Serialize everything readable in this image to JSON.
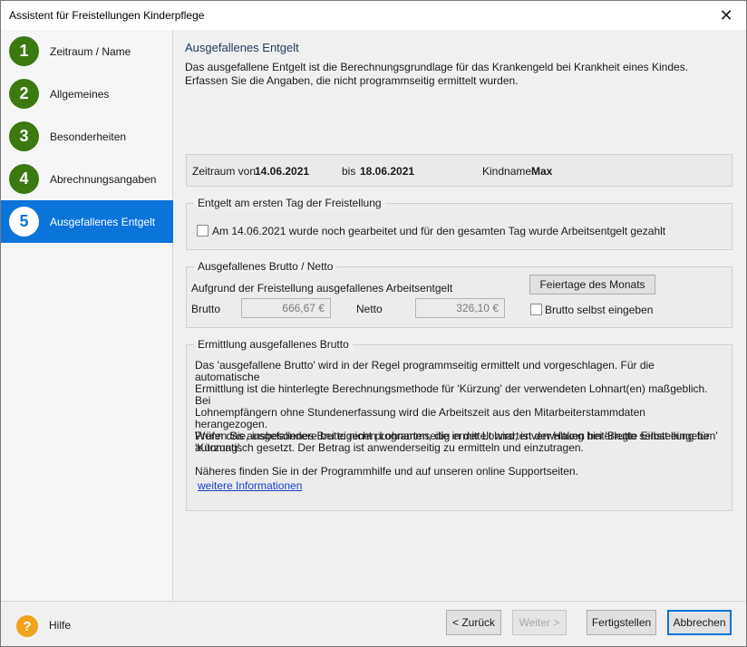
{
  "window": {
    "title": "Assistent für Freistellungen Kinderpflege",
    "close": "✕"
  },
  "steps": [
    {
      "num": "1",
      "label": "Zeitraum / Name"
    },
    {
      "num": "2",
      "label": "Allgemeines"
    },
    {
      "num": "3",
      "label": "Besonderheiten"
    },
    {
      "num": "4",
      "label": "Abrechnungsangaben"
    },
    {
      "num": "5",
      "label": "Ausgefallenes Entgelt"
    }
  ],
  "main": {
    "heading": "Ausgefallenes Entgelt",
    "description_line1": "Das ausgefallene Entgelt ist die Berechnungsgrundlage für das Krankengeld bei Krankheit eines Kindes.",
    "description_line2": "Erfassen Sie die Angaben, die nicht programmseitig ermittelt wurden."
  },
  "period": {
    "from_label": "Zeitraum von",
    "from_value": "14.06.2021",
    "to_label": "bis",
    "to_value": "18.06.2021",
    "child_label": "Kindname",
    "child_value": "Max"
  },
  "first_day": {
    "legend": "Entgelt am ersten Tag der Freistellung",
    "checkbox_label": "Am 14.06.2021 wurde noch gearbeitet und für den gesamten Tag wurde Arbeitsentgelt gezahlt"
  },
  "gross_net": {
    "legend": "Ausgefallenes Brutto / Netto",
    "subtitle": "Aufgrund der Freistellung ausgefallenes Arbeitsentgelt",
    "brutto_label": "Brutto",
    "brutto_value": "666,67 €",
    "netto_label": "Netto",
    "netto_value": "326,10 €",
    "holidays_button": "Feiertage des Monats",
    "self_entry_label": "Brutto selbst eingeben"
  },
  "determination": {
    "legend": "Ermittlung ausgefallenes Brutto",
    "p1_lines": [
      "Das 'ausgefallene Brutto' wird in der Regel programmseitig ermittelt und vorgeschlagen. Für die automatische",
      "Ermittlung ist die hinterlegte Berechnungsmethode für 'Kürzung' der verwendeten Lohnart(en) maßgeblich. Bei",
      "Lohnempfängern ohne Stundenerfassung wird die Arbeitszeit aus den Mitarbeiterstammdaten herangezogen.",
      "Wenn das ausgefallenes Brutto nicht programmseitig ermittelt wird, ist der Haken bei 'Brutto selbst eingeben'",
      "automatisch gesetzt. Der Betrag ist anwenderseitig zu ermitteln und einzutragen."
    ],
    "p2_lines": [
      "Prüfen Sie, insbesondere bei eigenen Lohnarten, die in der Lohnartenverwaltung hinterlegte Einstellung für",
      "'Kürzung'."
    ],
    "p3": "Näheres finden Sie in der Programmhilfe und auf unseren online Supportseiten.",
    "link": "weitere Informationen"
  },
  "footer": {
    "help_icon": "?",
    "help_label": "Hilfe",
    "back": "< Zurück",
    "next": "Weiter >",
    "finish": "Fertigstellen",
    "cancel": "Abbrechen"
  }
}
